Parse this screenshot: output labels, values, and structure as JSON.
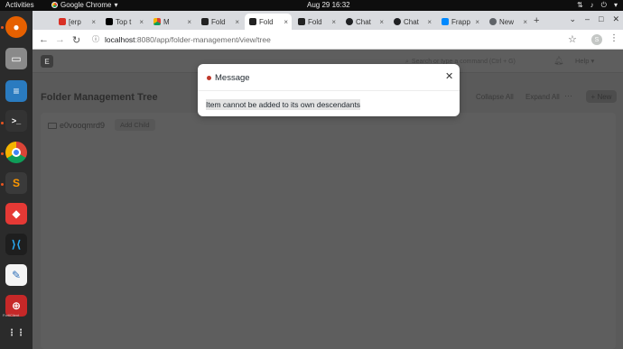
{
  "topbar": {
    "activities": "Activities",
    "app_name": "Google Chrome",
    "app_menu_arrow": "▾",
    "datetime": "Aug 29  16:32"
  },
  "dock": {
    "items": [
      {
        "name": "firefox",
        "color": "#e66000"
      },
      {
        "name": "files",
        "color": "#8a8a8a"
      },
      {
        "name": "libreoffice-writer",
        "color": "#2a7bc0"
      },
      {
        "name": "terminal",
        "color": "#333333"
      },
      {
        "name": "chrome",
        "color": "#4285f4"
      },
      {
        "name": "sublime-text",
        "color": "#ff9800"
      },
      {
        "name": "anydesk",
        "color": "#e53935"
      },
      {
        "name": "vscode",
        "color": "#1e88e5"
      },
      {
        "name": "text-editor",
        "color": "#2e6fb8"
      },
      {
        "name": "fortinet-vpn",
        "color": "#c62828"
      },
      {
        "name": "show-apps",
        "color": "#2b2b2b"
      }
    ],
    "vpn_label": "FortiClient"
  },
  "tabs": [
    {
      "label": "[erp",
      "fav_color": "#d93025",
      "active": false
    },
    {
      "label": "Top t",
      "fav_color": "#000000",
      "active": false
    },
    {
      "label": "M",
      "fav_color": "#ea4335",
      "active": false
    },
    {
      "label": "Fold",
      "fav_color": "#222222",
      "active": false
    },
    {
      "label": "Fold",
      "fav_color": "#222222",
      "active": true
    },
    {
      "label": "Fold",
      "fav_color": "#222222",
      "active": false
    },
    {
      "label": "Chat",
      "fav_color": "#202124",
      "active": false
    },
    {
      "label": "Chat",
      "fav_color": "#202124",
      "active": false
    },
    {
      "label": "Frapp",
      "fav_color": "#0089ff",
      "active": false
    },
    {
      "label": "New",
      "fav_color": "#5f6368",
      "active": false
    }
  ],
  "toolbar": {
    "url_host": "localhost",
    "url_path": ":8080/app/folder-management/view/tree",
    "profile_initial": "S"
  },
  "app": {
    "logo_letter": "E",
    "search_placeholder": "Search or type a command (Ctrl + G)",
    "help_label": "Help",
    "page_title": "Folder Management Tree",
    "collapse_all": "Collapse All",
    "expand_all": "Expand All",
    "menu_dots": "···",
    "new_button": "+ New",
    "tree_node": "e0vooqmrd9",
    "add_child": "Add Child"
  },
  "modal": {
    "title": "Message",
    "message": "Item cannot be added to its own descendants",
    "indicator_color": "#c0392b"
  }
}
